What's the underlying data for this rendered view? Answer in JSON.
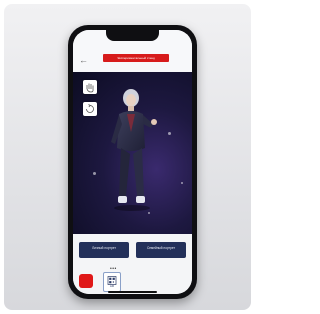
{
  "frame": {
    "card_gradient": [
      "#f1f1f3",
      "#d7d8dc"
    ],
    "phone_color": "#0f0f12"
  },
  "app": {
    "back_icon": "back-arrow-icon",
    "banner_text": "Экспериментальный стенд",
    "banner_color": "#d71b1b",
    "tools": [
      {
        "icon": "hand-icon"
      },
      {
        "icon": "rotate-icon"
      }
    ],
    "stage_colors": [
      "#3a2a6e",
      "#0c0c22"
    ]
  },
  "options": {
    "left_label": "Личный портрет",
    "right_label": "Семейный портрет",
    "button_color": "#23305a"
  },
  "controls": {
    "pager": "•••",
    "record_color": "#e01818",
    "qr_icon": "qr-code-icon",
    "qr_label": "AR"
  }
}
